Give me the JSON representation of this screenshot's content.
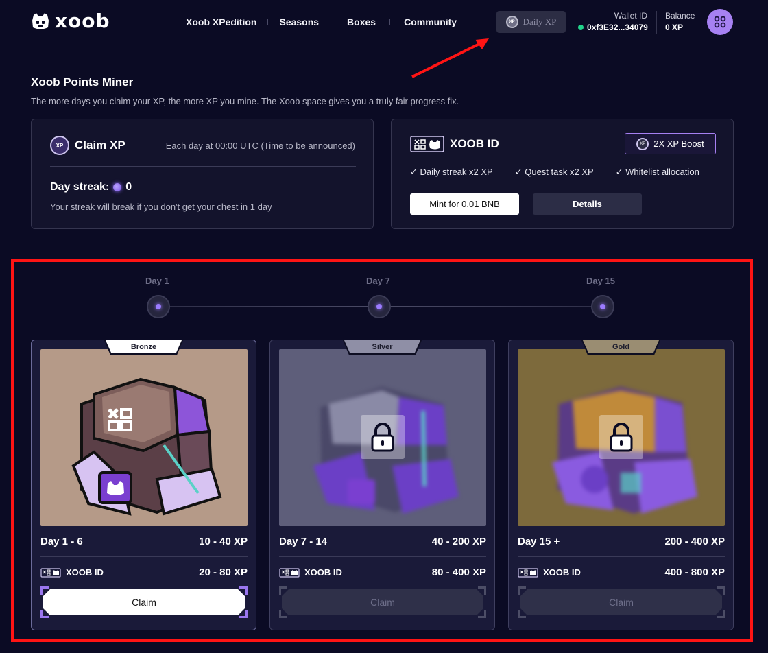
{
  "header": {
    "logo_text": "xoob",
    "nav": [
      "Xoob XPedition",
      "Seasons",
      "Boxes",
      "Community"
    ],
    "daily_xp_label": "Daily XP",
    "wallet_label": "Wallet ID",
    "wallet_value": "0xf3E32...34079",
    "balance_label": "Balance",
    "balance_value": "0 XP"
  },
  "intro": {
    "title": "Xoob Points Miner",
    "subtitle": "The more days you claim your XP, the more XP you mine. The Xoob space gives you a truly fair progress fix."
  },
  "claim_panel": {
    "badge": "XP",
    "title": "Claim XP",
    "note": "Each day at 00:00 UTC (Time to be announced)",
    "streak_label": "Day streak:",
    "streak_value": "0",
    "streak_note": "Your streak will break if you don't get your chest in 1 day"
  },
  "id_panel": {
    "title": "XOOB ID",
    "boost_label": "2X XP Boost",
    "perks": [
      "✓ Daily streak x2 XP",
      "✓ Quest task x2 XP",
      "✓ Whitelist allocation"
    ],
    "mint_label": "Mint for 0.01 BNB",
    "details_label": "Details"
  },
  "timeline": [
    "Day 1",
    "Day 7",
    "Day 15"
  ],
  "cards": [
    {
      "tier": "Bronze",
      "days": "Day 1 - 6",
      "xp": "10 - 40 XP",
      "id_label": "XOOB ID",
      "id_xp": "20 - 80 XP",
      "claim_label": "Claim",
      "locked": false
    },
    {
      "tier": "Silver",
      "days": "Day 7 - 14",
      "xp": "40 - 200 XP",
      "id_label": "XOOB ID",
      "id_xp": "80 - 400 XP",
      "claim_label": "Claim",
      "locked": true
    },
    {
      "tier": "Gold",
      "days": "Day 15 +",
      "xp": "200 - 400 XP",
      "id_label": "XOOB ID",
      "id_xp": "400 - 800 XP",
      "claim_label": "Claim",
      "locked": true
    }
  ],
  "colors": {
    "background": "#0b0b24",
    "accent": "#a681f2",
    "highlight_frame": "#ff1414",
    "bronze_bg": "#b59a88",
    "silver_bg": "#5e5e7a",
    "gold_bg": "#7d6a3c"
  }
}
